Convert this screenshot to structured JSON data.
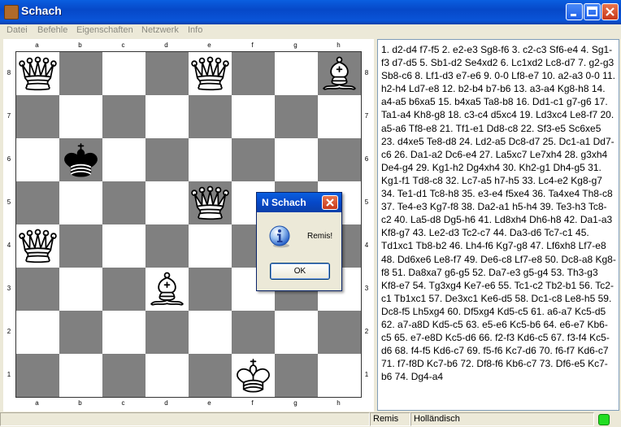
{
  "window": {
    "title": "Schach"
  },
  "menu": {
    "items": [
      "Datei",
      "Befehle",
      "Eigenschaften",
      "Netzwerk",
      "Info"
    ]
  },
  "board": {
    "files": [
      "a",
      "b",
      "c",
      "d",
      "e",
      "f",
      "g",
      "h"
    ],
    "ranks": [
      "8",
      "7",
      "6",
      "5",
      "4",
      "3",
      "2",
      "1"
    ],
    "pieces": [
      {
        "square": "a8",
        "type": "queen",
        "color": "white"
      },
      {
        "square": "e8",
        "type": "queen",
        "color": "white"
      },
      {
        "square": "h8",
        "type": "bishop",
        "color": "white"
      },
      {
        "square": "b6",
        "type": "king",
        "color": "black"
      },
      {
        "square": "e5",
        "type": "queen",
        "color": "white"
      },
      {
        "square": "a4",
        "type": "queen",
        "color": "white"
      },
      {
        "square": "d3",
        "type": "bishop",
        "color": "white"
      },
      {
        "square": "f1",
        "type": "king",
        "color": "white"
      }
    ],
    "colors": {
      "dark": "#808080",
      "light": "#ffffff"
    }
  },
  "moves": {
    "text": "1. d2-d4 f7-f5 2. e2-e3 Sg8-f6 3. c2-c3 Sf6-e4 4. Sg1-f3 d7-d5 5. Sb1-d2 Se4xd2 6. Lc1xd2 Lc8-d7 7. g2-g3 Sb8-c6 8. Lf1-d3 e7-e6 9. 0-0 Lf8-e7 10. a2-a3 0-0 11. h2-h4 Ld7-e8 12. b2-b4 b7-b6 13. a3-a4 Kg8-h8 14. a4-a5 b6xa5 15. b4xa5 Ta8-b8 16. Dd1-c1 g7-g6 17. Ta1-a4 Kh8-g8 18. c3-c4 d5xc4 19. Ld3xc4 Le8-f7 20. a5-a6 Tf8-e8 21. Tf1-e1 Dd8-c8 22. Sf3-e5 Sc6xe5 23. d4xe5 Te8-d8 24. Ld2-a5 Dc8-d7 25. Dc1-a1 Dd7-c6 26. Da1-a2 Dc6-e4 27. La5xc7 Le7xh4 28. g3xh4 De4-g4 29. Kg1-h2 Dg4xh4 30. Kh2-g1 Dh4-g5 31. Kg1-f1 Td8-c8 32. Lc7-a5 h7-h5 33. Lc4-e2 Kg8-g7 34. Te1-d1 Tc8-h8 35. e3-e4 f5xe4 36. Ta4xe4 Th8-c8 37. Te4-e3 Kg7-f8 38. Da2-a1 h5-h4 39. Te3-h3 Tc8-c2 40. La5-d8 Dg5-h6 41. Ld8xh4 Dh6-h8 42. Da1-a3 Kf8-g7 43. Le2-d3 Tc2-c7 44. Da3-d6 Tc7-c1 45. Td1xc1 Tb8-b2 46. Lh4-f6 Kg7-g8 47. Lf6xh8 Lf7-e8 48. Dd6xe6 Le8-f7 49. De6-c8 Lf7-e8 50. Dc8-a8 Kg8-f8 51. Da8xa7 g6-g5 52. Da7-e3 g5-g4 53. Th3-g3 Kf8-e7 54. Tg3xg4 Ke7-e6 55. Tc1-c2 Tb2-b1 56. Tc2-c1 Tb1xc1 57. De3xc1 Ke6-d5 58. Dc1-c8 Le8-h5 59. Dc8-f5 Lh5xg4 60. Df5xg4 Kd5-c5 61. a6-a7 Kc5-d5 62. a7-a8D Kd5-c5 63. e5-e6 Kc5-b6 64. e6-e7 Kb6-c5 65. e7-e8D Kc5-d6 66. f2-f3 Kd6-c5 67. f3-f4 Kc5-d6 68. f4-f5 Kd6-c7 69. f5-f6 Kc7-d6 70. f6-f7 Kd6-c7 71. f7-f8D Kc7-b6 72. Df8-f6 Kb6-c7 73. Df6-e5 Kc7-b6 74. Dg4-a4"
  },
  "status": {
    "result": "Remis",
    "opening": "Holländisch",
    "led_color": "#22dd22"
  },
  "dialog": {
    "title": "N Schach",
    "message": "Remis!",
    "ok_label": "OK",
    "icon": "info-icon"
  }
}
